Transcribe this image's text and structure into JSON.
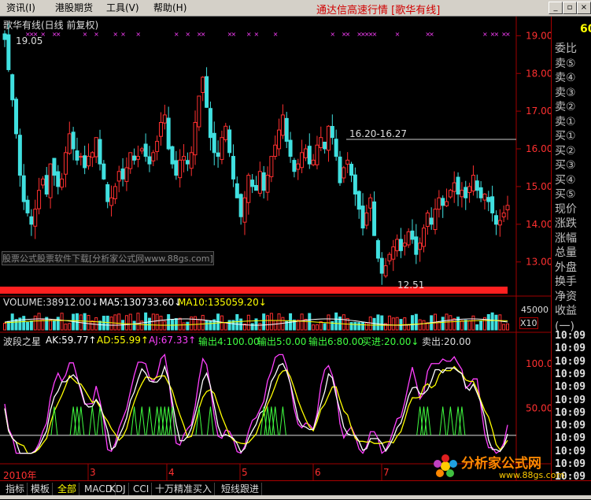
{
  "menubar": {
    "items": [
      "资讯(I)",
      "港股期货",
      "工具(V)",
      "帮助(H)"
    ],
    "title": "通达信高速行情 [歌华有线]"
  },
  "chart_header": {
    "name": "歌华有线(日线 前复权)",
    "high_label": "19.05",
    "low_label": "12.51",
    "range_label": "16.20-16.27",
    "watermark": "股票公式股票软件下载[分析家公式网www.88gs.com]"
  },
  "price_axis": [
    "19.00",
    "18.00",
    "17.00",
    "16.00",
    "15.00",
    "14.00",
    "13.00"
  ],
  "volume_header": {
    "volume": "VOLUME:38912.00↓",
    "ma5": "MA5:130733.60↓",
    "ma10": "MA10:135059.20↓",
    "axis_label": "45000",
    "unit": "X10"
  },
  "indicator_header": {
    "name": "波段之星",
    "ak": "AK:59.77↑",
    "ad": "AD:55.99↑",
    "aj": "AJ:67.33↑",
    "out1": "输出4:100.00",
    "out2": "输出5:0.00",
    "out3": "输出6:80.00",
    "buy": "买进:20.00↓",
    "sell": "卖出:20.00"
  },
  "indicator_axis": [
    "100.0",
    "50.00"
  ],
  "time_axis": {
    "year": "2010年",
    "months": [
      "3",
      "4",
      "5",
      "6",
      "7"
    ]
  },
  "right_panel": {
    "code_fragment": "60",
    "items": [
      "委比",
      "卖⑤",
      "卖④",
      "卖③",
      "卖②",
      "卖①",
      "买①",
      "买②",
      "买③",
      "买④",
      "买⑤",
      "现价",
      "涨跌",
      "涨幅",
      "总量",
      "外盘",
      "换手",
      "净资",
      "收益(一)"
    ],
    "times": [
      "10:09",
      "10:09",
      "10:09",
      "10:09",
      "10:09",
      "10:09",
      "10:09",
      "10:09",
      "10:09",
      "10:09",
      "10:09",
      "10:09",
      "10:09"
    ]
  },
  "bottom_tabs": [
    "指标",
    "模板",
    "全部",
    "MACD",
    "KDJ",
    "CCI",
    "十万精准买入",
    "短线跟进"
  ],
  "logo_text": "分析家公式网",
  "logo_url": "www.88gs.com",
  "colors": {
    "up": "#ff3030",
    "down": "#40e0e0",
    "ma5": "#ffffff",
    "ma10": "#ffff00",
    "ak": "#ffffff",
    "ad": "#ffff00",
    "aj": "#ff40ff",
    "signal": "#40ff40"
  },
  "chart_data": {
    "type": "candlestick",
    "price_range": [
      12.2,
      19.3
    ],
    "closes": [
      18.9,
      18.1,
      17.3,
      16.4,
      15.3,
      14.6,
      14.3,
      14.0,
      14.4,
      14.9,
      15.2,
      14.8,
      15.6,
      15.3,
      15.0,
      15.2,
      15.9,
      16.4,
      16.0,
      15.7,
      15.8,
      15.5,
      15.8,
      15.9,
      16.3,
      15.6,
      15.2,
      14.6,
      14.7,
      15.0,
      15.4,
      15.2,
      15.5,
      15.9,
      15.7,
      15.8,
      16.0,
      15.8,
      15.6,
      15.9,
      16.2,
      16.7,
      16.9,
      16.0,
      15.6,
      15.3,
      15.7,
      15.8,
      15.6,
      15.9,
      16.7,
      17.4,
      17.9,
      17.1,
      16.3,
      15.9,
      15.8,
      16.3,
      16.6,
      15.9,
      15.2,
      14.7,
      14.2,
      14.7,
      15.3,
      15.0,
      14.9,
      15.4,
      14.9,
      15.3,
      15.8,
      16.1,
      16.5,
      16.9,
      16.2,
      15.8,
      15.4,
      15.6,
      15.9,
      16.0,
      15.6,
      15.7,
      16.1,
      16.3,
      16.0,
      16.6,
      16.3,
      15.8,
      15.1,
      15.5,
      15.7,
      15.3,
      14.8,
      14.4,
      13.9,
      14.3,
      14.7,
      13.7,
      13.1,
      12.7,
      12.9,
      13.2,
      13.4,
      13.6,
      13.3,
      13.5,
      13.8,
      13.6,
      13.2,
      13.5,
      13.9,
      14.3,
      14.0,
      14.4,
      14.7,
      14.5,
      14.6,
      14.9,
      15.1,
      14.8,
      14.9,
      14.7,
      15.0,
      15.3,
      14.9,
      14.7,
      14.8,
      14.6,
      14.3,
      14.0,
      14.1,
      14.3,
      14.5
    ]
  }
}
